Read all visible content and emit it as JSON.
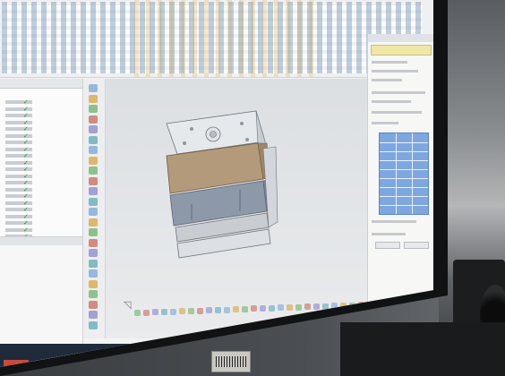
{
  "app": {
    "title": "",
    "ribbon_tabs": []
  },
  "left_panel": {
    "header": "",
    "columns": [
      "",
      ""
    ],
    "rows": 21,
    "check_mark": "✓",
    "lower_header": "",
    "lower_text": ""
  },
  "viewport": {
    "model": "mold-assembly-3d",
    "axis_glyph": "◹"
  },
  "right_panel": {
    "title": "",
    "selected_value": "",
    "table_headers": [
      "",
      ""
    ],
    "table_rows": 9,
    "ok_label": "",
    "cancel_label": ""
  },
  "taskbar": {
    "items": 6
  },
  "colors": {
    "ribbon_bg": "#eef0f2",
    "viewport_bg": "#e3e6e9",
    "panel_highlight": "#efe7a6",
    "table_selection": "#7ea7e0",
    "mold_top_plate": "#e6e9ec",
    "mold_middle_plate": "#b39a7a",
    "mold_lower_plate": "#8d98a8",
    "check_color": "#2f8a3a"
  }
}
